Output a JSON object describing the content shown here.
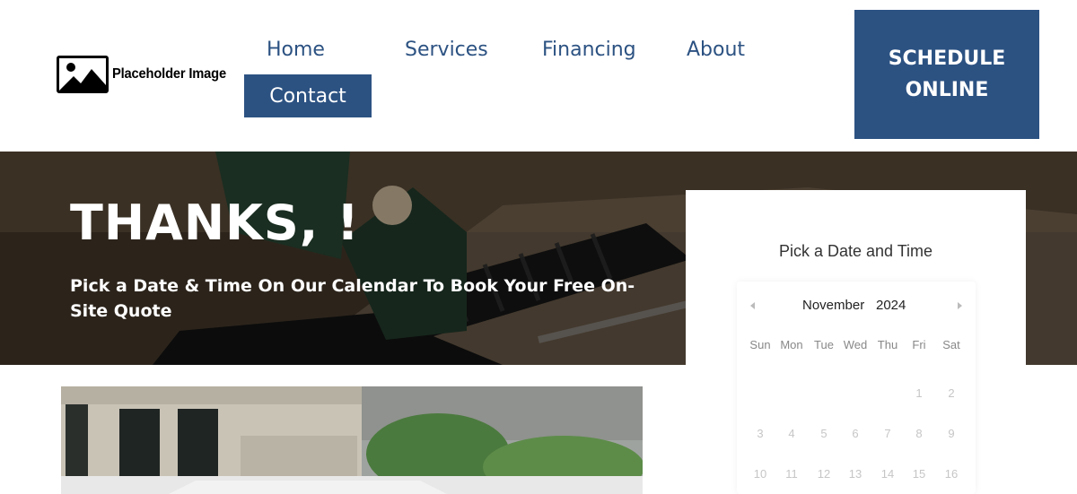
{
  "logo": {
    "text": "Placeholder Image",
    "icon": "image-placeholder-icon"
  },
  "nav": {
    "items": [
      {
        "label": "Home"
      },
      {
        "label": "Services"
      },
      {
        "label": "Financing"
      },
      {
        "label": "About"
      },
      {
        "label": "Contact"
      }
    ]
  },
  "schedule_button": {
    "line1": "SCHEDULE",
    "line2": "ONLINE"
  },
  "hero": {
    "title": "THANKS, !",
    "subtitle": "Pick a Date & Time On Our Calendar To Book Your Free On-Site Quote"
  },
  "calendar": {
    "heading": "Pick a Date and Time",
    "month": "November",
    "year": "2024",
    "weekdays": [
      "Sun",
      "Mon",
      "Tue",
      "Wed",
      "Thu",
      "Fri",
      "Sat"
    ],
    "weeks": [
      [
        "",
        "",
        "",
        "",
        "",
        "1",
        "2"
      ],
      [
        "3",
        "4",
        "5",
        "6",
        "7",
        "8",
        "9"
      ],
      [
        "10",
        "11",
        "12",
        "13",
        "14",
        "15",
        "16"
      ]
    ]
  },
  "colors": {
    "brand_blue": "#2c5282",
    "white": "#ffffff"
  }
}
